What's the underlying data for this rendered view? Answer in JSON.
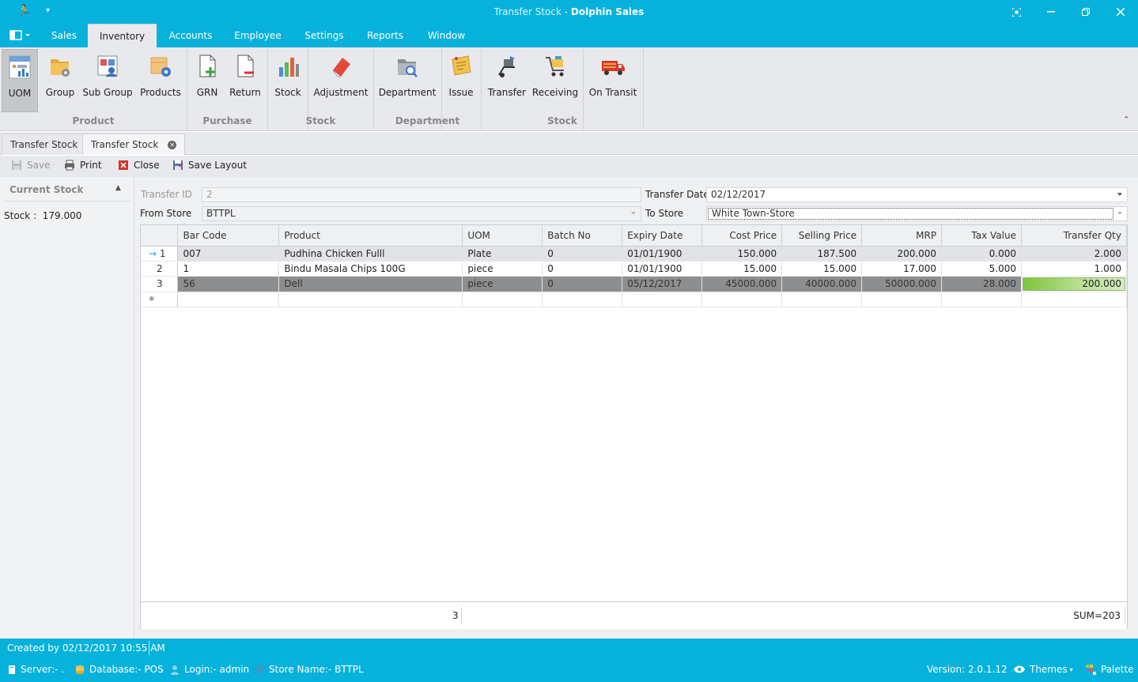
{
  "window": {
    "title_part1": "Transfer Stock - ",
    "title_part2": "Dolphin Sales",
    "minimize": "—",
    "restore": "❐",
    "close": "✕",
    "fullscreen": "⛶"
  },
  "menu": {
    "items": [
      "Sales",
      "Inventory",
      "Accounts",
      "Employee",
      "Settings",
      "Reports",
      "Window"
    ],
    "active": "Inventory"
  },
  "ribbon": {
    "buttons": {
      "uom": "UOM",
      "group": "Group",
      "sub_group": "Sub Group",
      "products": "Products",
      "grn": "GRN",
      "return": "Return",
      "stock": "Stock",
      "adjustment": "Adjustment",
      "department": "Department",
      "issue": "Issue",
      "transfer": "Transfer",
      "receiving": "Receiving",
      "on_transit": "On Transit"
    },
    "groups": {
      "product": "Product",
      "purchase": "Purchase",
      "stock1": "Stock",
      "department": "Department",
      "stock2": "Stock"
    }
  },
  "tabs": [
    "Transfer Stock",
    "Transfer Stock"
  ],
  "toolbar": {
    "save": "Save",
    "print": "Print",
    "close": "Close",
    "save_layout": "Save Layout"
  },
  "left_panel": {
    "header": "Current Stock",
    "stock_label": "Stock :",
    "stock_value": "179.000"
  },
  "form": {
    "transfer_id_label": "Transfer ID",
    "transfer_id_value": "2",
    "transfer_date_label": "Transfer Date",
    "transfer_date_value": "02/12/2017",
    "from_store_label": "From Store",
    "from_store_value": "BTTPL",
    "to_store_label": "To Store",
    "to_store_value": "White Town-Store"
  },
  "grid": {
    "columns": [
      "Bar Code",
      "Product",
      "UOM",
      "Batch No",
      "Expiry Date",
      "Cost Price",
      "Selling Price",
      "MRP",
      "Tax Value",
      "Transfer Qty"
    ],
    "rows": [
      {
        "num": "1",
        "bar_code": "007",
        "product": "Pudhina Chicken Fulll",
        "uom": "Plate",
        "batch_no": "0",
        "expiry": "01/01/1900",
        "cost": "150.000",
        "selling": "187.500",
        "mrp": "200.000",
        "tax": "0.000",
        "qty": "2.000"
      },
      {
        "num": "2",
        "bar_code": "1",
        "product": "Bindu Masala Chips 100G",
        "uom": "piece",
        "batch_no": "0",
        "expiry": "01/01/1900",
        "cost": "15.000",
        "selling": "15.000",
        "mrp": "17.000",
        "tax": "5.000",
        "qty": "1.000"
      },
      {
        "num": "3",
        "bar_code": "56",
        "product": "Dell",
        "uom": "piece",
        "batch_no": "0",
        "expiry": "05/12/2017",
        "cost": "45000.000",
        "selling": "40000.000",
        "mrp": "50000.000",
        "tax": "28.000",
        "qty": "200.000"
      }
    ],
    "new_row_marker": "✱",
    "current_row_marker": "→",
    "footer_count": "3",
    "footer_sum": "SUM=203"
  },
  "status": {
    "created": "Created by 02/12/2017 10:55 AM",
    "server": "Server:- .",
    "database": "Database:- POS",
    "login": "Login:- admin",
    "store": "Store Name:- BTTPL",
    "version": "Version: 2.0.1.12",
    "themes": "Themes",
    "palette": "Palette"
  },
  "colors": {
    "accent": "#06b2dc",
    "ribbon_bg": "#e8e9ec",
    "selected_row": "#8d8e90",
    "qty_bar": "#7cc53a"
  }
}
